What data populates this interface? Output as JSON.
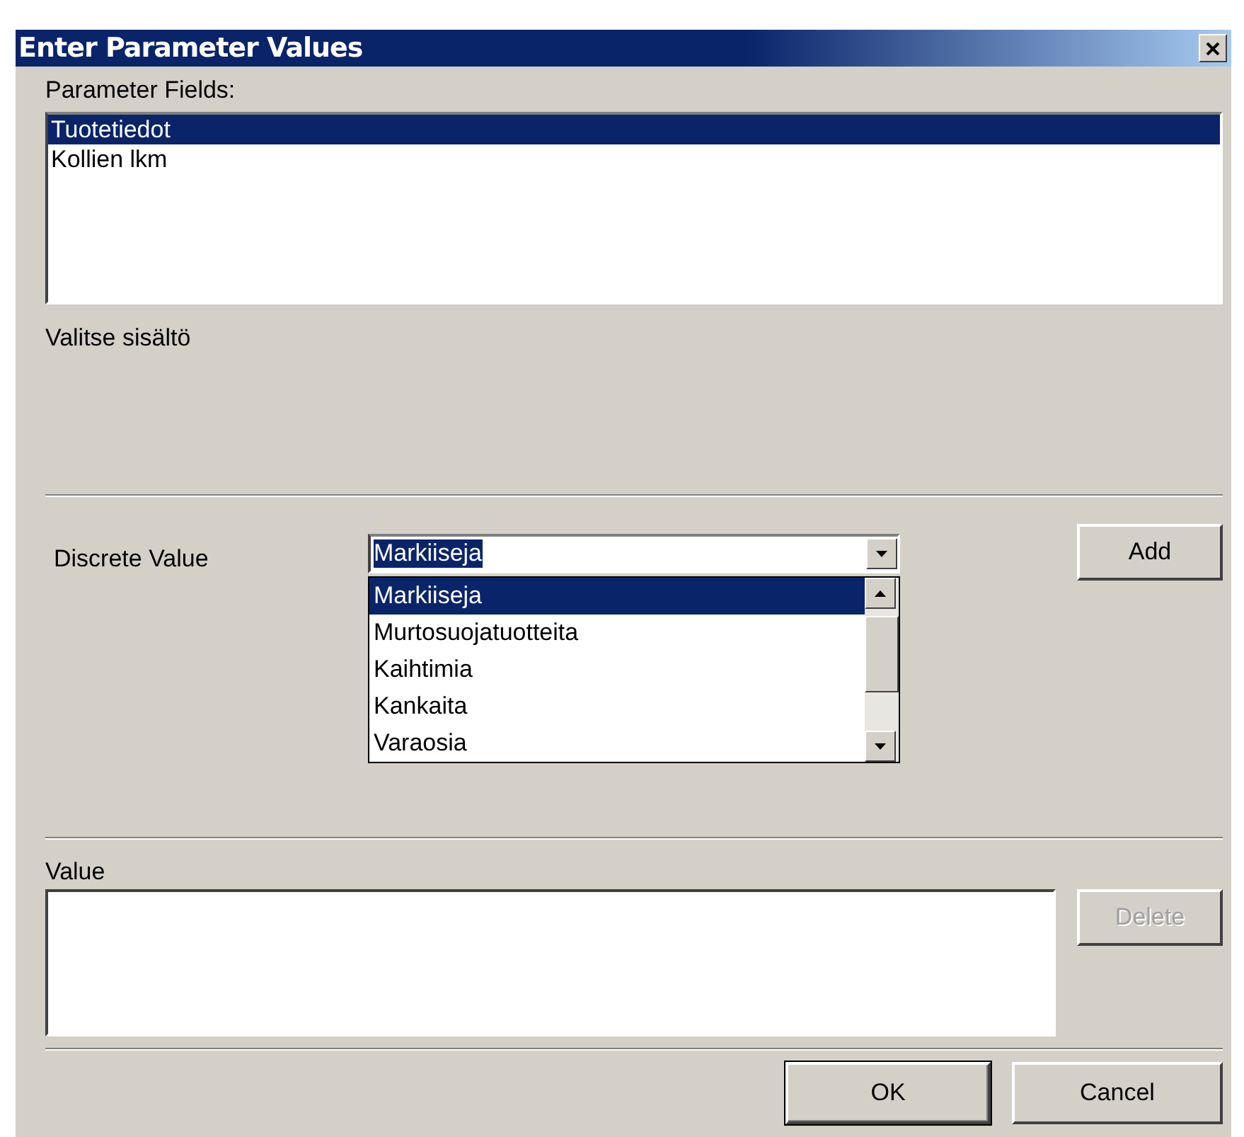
{
  "window": {
    "title": "Enter Parameter Values"
  },
  "parameter_fields": {
    "label": "Parameter Fields:",
    "items": [
      {
        "label": "Tuotetiedot",
        "selected": true
      },
      {
        "label": "Kollien lkm",
        "selected": false
      }
    ]
  },
  "prompt": "Valitse sisältö",
  "discrete_value": {
    "label": "Discrete Value",
    "value": "Markiiseja",
    "expanded": true,
    "options": [
      {
        "label": "Markiiseja",
        "selected": true
      },
      {
        "label": "Murtosuojatuotteita",
        "selected": false
      },
      {
        "label": "Kaihtimia",
        "selected": false
      },
      {
        "label": "Kankaita",
        "selected": false
      },
      {
        "label": "Varaosia",
        "selected": false
      }
    ]
  },
  "value": {
    "label": "Value"
  },
  "buttons": [
    {
      "kind": "add",
      "label": "Add",
      "disabled": false,
      "default": false
    },
    {
      "kind": "delete",
      "label": "Delete",
      "disabled": true,
      "default": false
    },
    {
      "kind": "ok",
      "label": "OK",
      "disabled": false,
      "default": true
    },
    {
      "kind": "cancel",
      "label": "Cancel",
      "disabled": false,
      "default": false
    }
  ]
}
